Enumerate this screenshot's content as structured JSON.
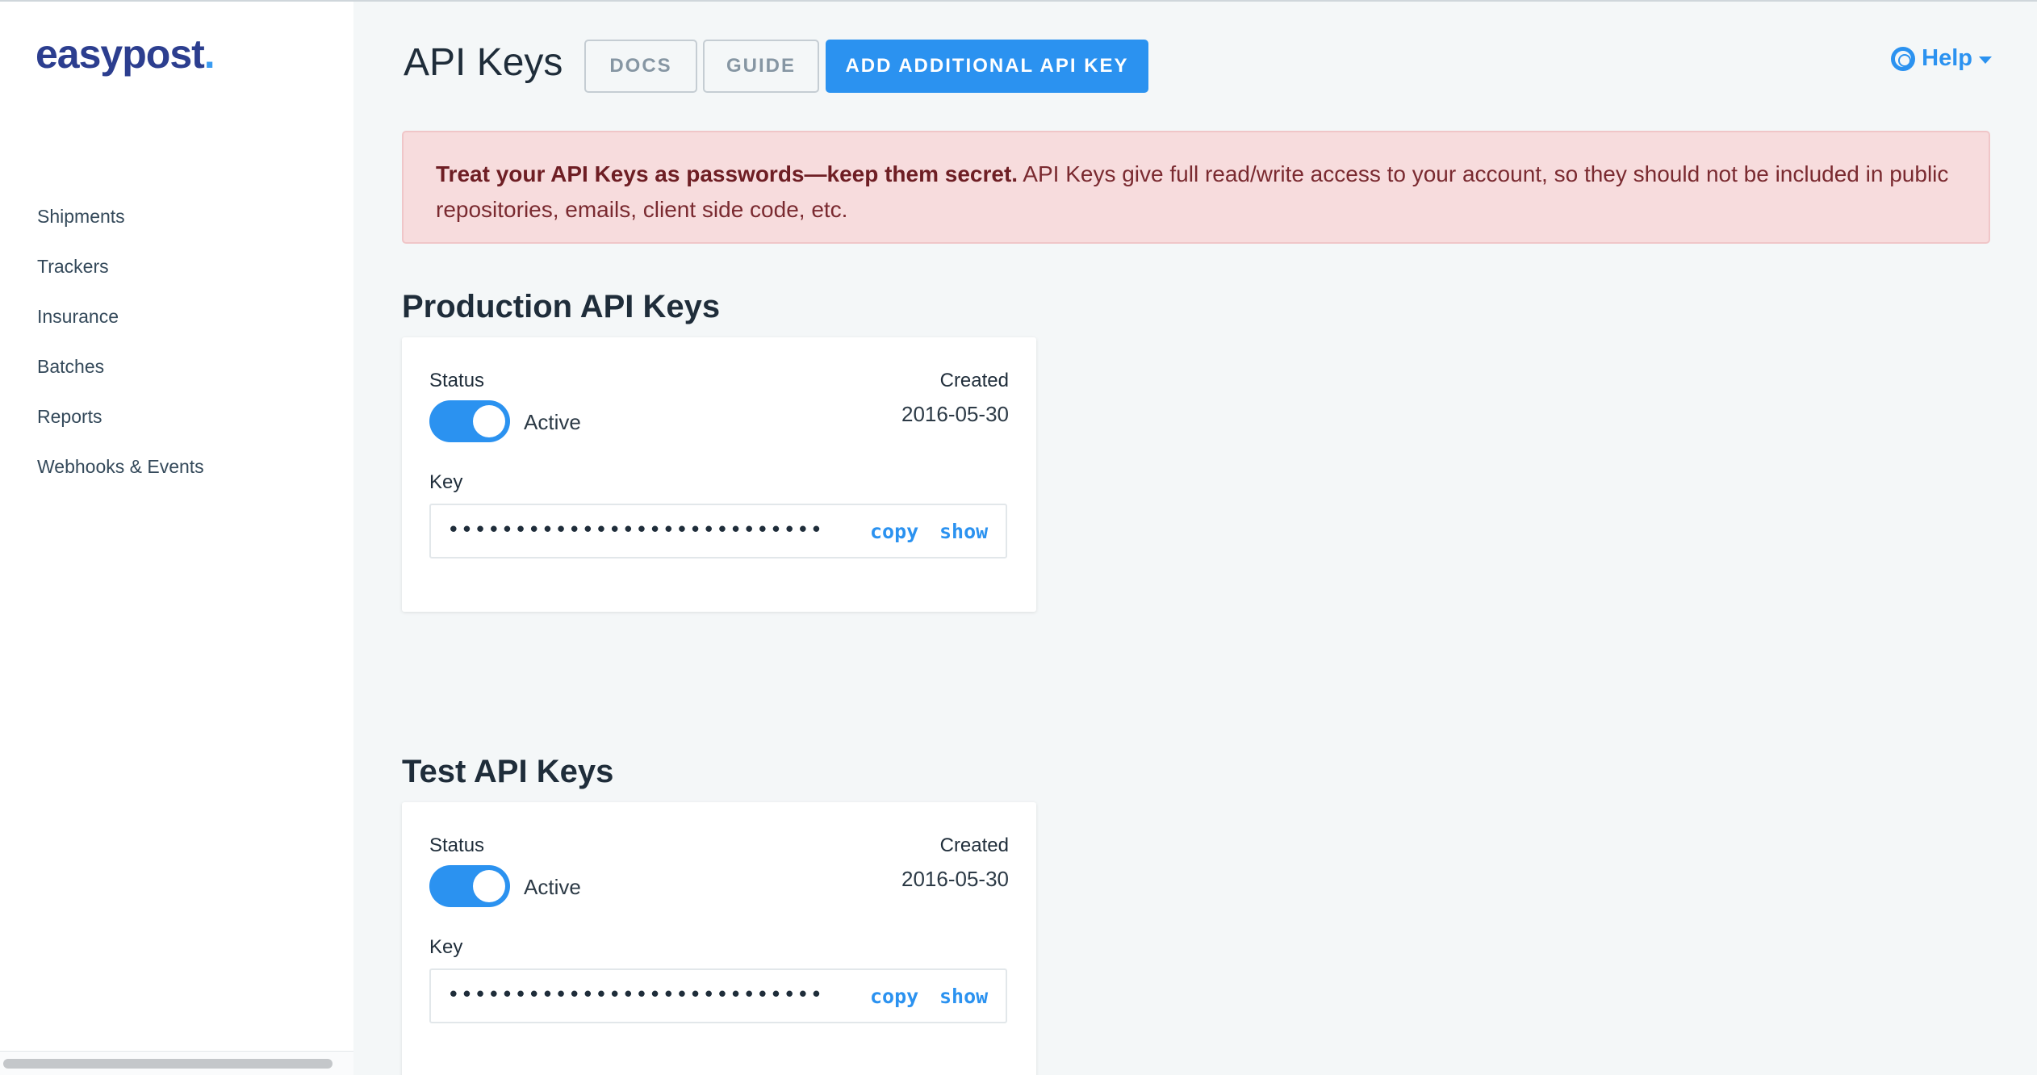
{
  "brand": {
    "logo_text": "easypost",
    "logo_dot": ".",
    "accent": "#2b92f0",
    "logo_color": "#2c3e8f"
  },
  "sidebar": {
    "items": [
      {
        "label": "Shipments"
      },
      {
        "label": "Trackers"
      },
      {
        "label": "Insurance"
      },
      {
        "label": "Batches"
      },
      {
        "label": "Reports"
      },
      {
        "label": "Webhooks & Events"
      }
    ]
  },
  "header": {
    "title": "API Keys",
    "docs_label": "DOCS",
    "guide_label": "GUIDE",
    "add_label": "ADD ADDITIONAL API KEY",
    "help_label": "Help"
  },
  "alert": {
    "strong": "Treat your API Keys as passwords—keep them secret.",
    "body": " API Keys give full read/write access to your account, so they should not be included in public repositories, emails, client side code, etc."
  },
  "production": {
    "title": "Production API Keys",
    "status_label": "Status",
    "status_value": "Active",
    "created_label": "Created",
    "created_value": "2016-05-30",
    "key_label": "Key",
    "key_masked": "••••••••••••••••••••••••••••",
    "copy_label": "copy",
    "show_label": "show"
  },
  "test": {
    "title": "Test API Keys",
    "status_label": "Status",
    "status_value": "Active",
    "created_label": "Created",
    "created_value": "2016-05-30",
    "key_label": "Key",
    "key_masked": "••••••••••••••••••••••••••••",
    "copy_label": "copy",
    "show_label": "show"
  }
}
